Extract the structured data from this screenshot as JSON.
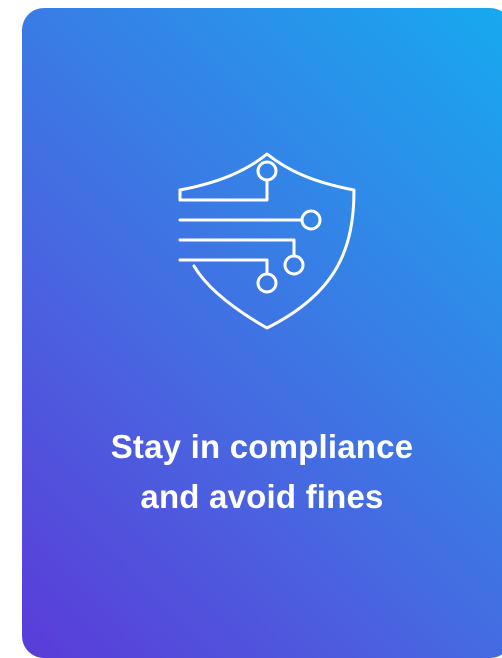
{
  "card": {
    "headline_line1": "Stay in compliance",
    "headline_line2": "and avoid fines",
    "icon": "shield-circuit-icon",
    "colors": {
      "gradient_top_right": "#16aaf0",
      "gradient_bottom_left": "#5a3bd8",
      "foreground": "#ffffff"
    }
  }
}
